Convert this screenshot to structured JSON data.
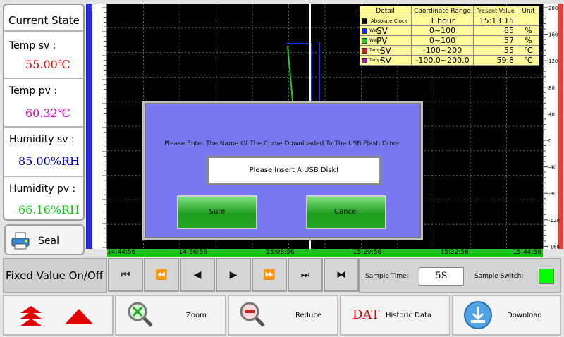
{
  "left_panel": {
    "title": "Current State",
    "temp_sv_label": "Temp sv :",
    "temp_sv_value": "55.00℃",
    "temp_pv_label": "Temp pv :",
    "temp_pv_value": "60.32℃",
    "hum_sv_label": "Humidity sv :",
    "hum_sv_value": "85.00%RH",
    "hum_pv_label": "Humidity pv :",
    "hum_pv_value": "66.16%RH",
    "colors": {
      "temp_sv": "#e00000",
      "temp_pv": "#e000e0",
      "hum_sv": "#0000c8",
      "hum_pv": "#00d000"
    }
  },
  "seal": {
    "label": "Seal",
    "icon": "seal-printer-icon"
  },
  "chart": {
    "left_axis_ticks": [
      "100",
      "90",
      "80",
      "70",
      "60",
      "50",
      "40",
      "30",
      "20",
      "10",
      "0"
    ],
    "right_axis_ticks": [
      "200",
      "160",
      "120",
      "80",
      "40",
      "0",
      "-40",
      "-80",
      "-120",
      "-160"
    ],
    "time_labels": [
      "14:44:56",
      "14:56:56",
      "15:08:56",
      "15:20:56",
      "15:32:56",
      "15:44:56"
    ],
    "legend": {
      "headers": [
        "Detail",
        "Coordinate Range",
        "Present Value",
        "Unit"
      ],
      "rows": [
        {
          "prefix": "",
          "name": "Absolute Clock",
          "range": "1 hour",
          "value": "15:13:15",
          "unit": "",
          "color": "#000000"
        },
        {
          "prefix": "Wet",
          "name": "SV",
          "range": "0~100",
          "value": "85",
          "unit": "%",
          "color": "#1a2bff"
        },
        {
          "prefix": "Wet",
          "name": "PV",
          "range": "0~100",
          "value": "57",
          "unit": "%",
          "color": "#1ad01a"
        },
        {
          "prefix": "Temp",
          "name": "SV",
          "range": "-100~200",
          "value": "55",
          "unit": "℃",
          "color": "#e02020"
        },
        {
          "prefix": "Temp",
          "name": "SV",
          "range": "-100.0~200.0",
          "value": "59.8",
          "unit": "℃",
          "color": "#a020a0"
        }
      ]
    }
  },
  "dialog": {
    "prompt": "Please Enter The Name Of The Curve Downloaded To The USB Flash Drive:",
    "input_value": "Please Insert A USB Disk!",
    "sure_label": "Sure",
    "cancel_label": "Cancel"
  },
  "controls": {
    "fixed_value_label": "Fixed Value On/Off",
    "nav_buttons": [
      {
        "name": "skip-to-start",
        "glyph": "⏮"
      },
      {
        "name": "fast-backward",
        "glyph": "⏪"
      },
      {
        "name": "step-backward",
        "glyph": "◀"
      },
      {
        "name": "step-forward",
        "glyph": "▶"
      },
      {
        "name": "fast-forward",
        "glyph": "⏩"
      },
      {
        "name": "skip-to-end",
        "glyph": "⏭"
      },
      {
        "name": "fit-range",
        "glyph": "⧓"
      }
    ],
    "sample_time_label": "Sample Time:",
    "sample_time_value": "5S",
    "sample_switch_label": "Sample Switch:",
    "sample_switch_color": "#00ff00"
  },
  "bottom": {
    "zoom_label": "Zoom",
    "reduce_label": "Reduce",
    "dat_label": "DAT",
    "historic_label": "Historic Data",
    "download_label": "Download"
  }
}
